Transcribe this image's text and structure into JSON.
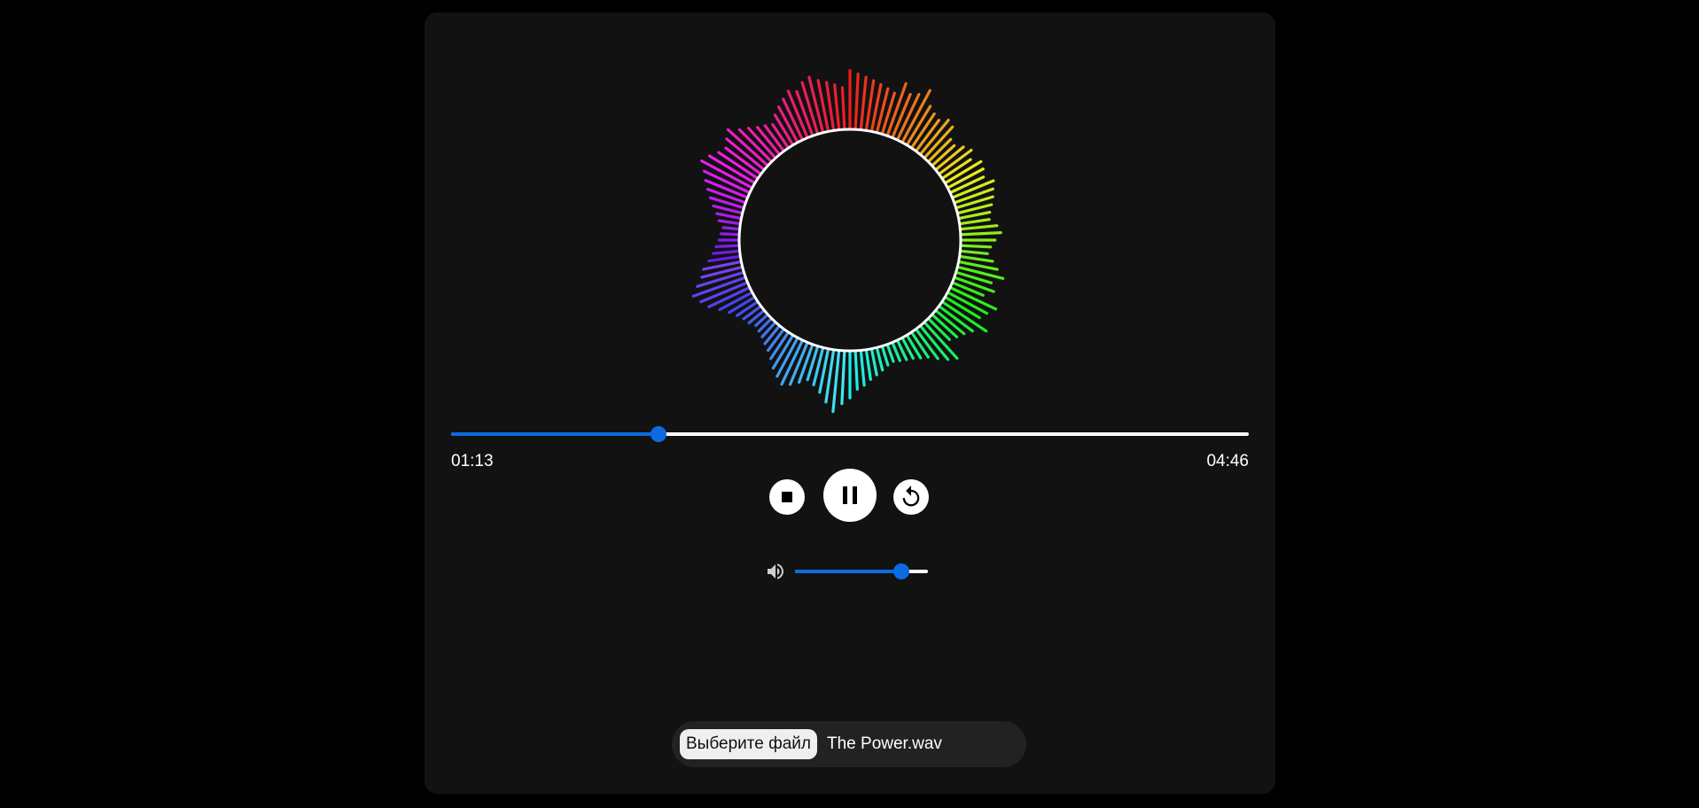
{
  "player": {
    "current_time": "01:13",
    "duration": "04:46",
    "progress": 0.26,
    "volume": 0.8
  },
  "file_input": {
    "button_label": "Выберите файл",
    "file_name": "The Power.wav"
  },
  "colors": {
    "background": "#000000",
    "card": "#121212",
    "accent": "#0a6ce0",
    "ring": "#ffffff"
  },
  "visualizer": {
    "levels": [
      0.62,
      0.58,
      0.55,
      0.52,
      0.49,
      0.46,
      0.43,
      0.58,
      0.48,
      0.52,
      0.62,
      0.46,
      0.41,
      0.38,
      0.45,
      0.42,
      0.3,
      0.28,
      0.35,
      0.4,
      0.33,
      0.42,
      0.4,
      0.36,
      0.45,
      0.41,
      0.38,
      0.34,
      0.3,
      0.28,
      0.36,
      0.4,
      0.33,
      0.28,
      0.25,
      0.32,
      0.39,
      0.48,
      0.36,
      0.42,
      0.32,
      0.52,
      0.45,
      0.4,
      0.55,
      0.42,
      0.36,
      0.32,
      0.28,
      0.5,
      0.44,
      0.36,
      0.28,
      0.24,
      0.2,
      0.18,
      0.16,
      0.14,
      0.16,
      0.2,
      0.24,
      0.28,
      0.34,
      0.38,
      0.48,
      0.55,
      0.65,
      0.55,
      0.45,
      0.38,
      0.34,
      0.4,
      0.46,
      0.5,
      0.44,
      0.38,
      0.3,
      0.24,
      0.2,
      0.16,
      0.14,
      0.12,
      0.16,
      0.18,
      0.22,
      0.28,
      0.36,
      0.46,
      0.52,
      0.58,
      0.5,
      0.42,
      0.38,
      0.3,
      0.24,
      0.2,
      0.16,
      0.14,
      0.12,
      0.18,
      0.22,
      0.28,
      0.34,
      0.4,
      0.46,
      0.52,
      0.6,
      0.55,
      0.48,
      0.44,
      0.5,
      0.56,
      0.46,
      0.4,
      0.34,
      0.3,
      0.26,
      0.34,
      0.4,
      0.46,
      0.52,
      0.48,
      0.56,
      0.6,
      0.54,
      0.5,
      0.46,
      0.42
    ]
  }
}
